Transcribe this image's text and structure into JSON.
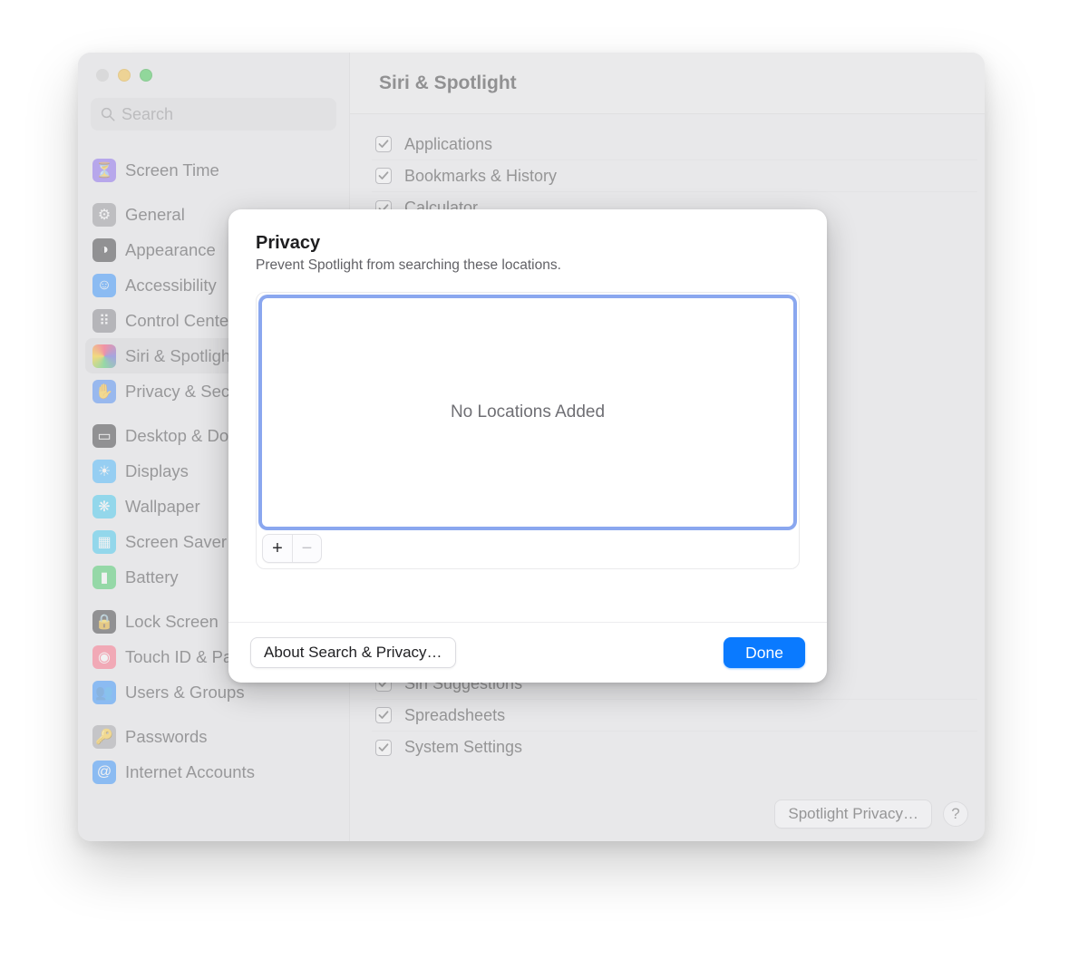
{
  "header": {
    "title": "Siri & Spotlight"
  },
  "search": {
    "placeholder": "Search"
  },
  "sidebar": {
    "groups": [
      {
        "items": [
          {
            "label": "Screen Time",
            "colorClass": "c-purple",
            "glyph": "⏳"
          }
        ]
      },
      {
        "items": [
          {
            "label": "General",
            "colorClass": "c-gray",
            "glyph": "⚙"
          },
          {
            "label": "Appearance",
            "colorClass": "c-black",
            "glyph": "◑"
          },
          {
            "label": "Accessibility",
            "colorClass": "c-blue",
            "glyph": "☺"
          },
          {
            "label": "Control Center",
            "colorClass": "c-darkgray",
            "glyph": "⠿"
          },
          {
            "label": "Siri & Spotlight",
            "colorClass": "c-siri",
            "glyph": "",
            "selected": true
          },
          {
            "label": "Privacy & Security",
            "colorClass": "c-hand",
            "glyph": "✋"
          }
        ]
      },
      {
        "items": [
          {
            "label": "Desktop & Dock",
            "colorClass": "c-black",
            "glyph": "▭"
          },
          {
            "label": "Displays",
            "colorClass": "c-bright",
            "glyph": "☀"
          },
          {
            "label": "Wallpaper",
            "colorClass": "c-teal",
            "glyph": "❋"
          },
          {
            "label": "Screen Saver",
            "colorClass": "c-teal",
            "glyph": "▦"
          },
          {
            "label": "Battery",
            "colorClass": "c-green",
            "glyph": "▮"
          }
        ]
      },
      {
        "items": [
          {
            "label": "Lock Screen",
            "colorClass": "c-black",
            "glyph": "🔒"
          },
          {
            "label": "Touch ID & Password",
            "colorClass": "c-pink",
            "glyph": "◉"
          },
          {
            "label": "Users & Groups",
            "colorClass": "c-blue",
            "glyph": "👥"
          }
        ]
      },
      {
        "items": [
          {
            "label": "Passwords",
            "colorClass": "c-lightgray",
            "glyph": "🔑"
          },
          {
            "label": "Internet Accounts",
            "colorClass": "c-blue",
            "glyph": "@"
          }
        ]
      }
    ]
  },
  "spotlight": {
    "results": [
      {
        "label": "Applications",
        "checked": true
      },
      {
        "label": "Bookmarks & History",
        "checked": true
      },
      {
        "label": "Calculator",
        "checked": true
      },
      {
        "label": "Siri Suggestions",
        "checked": true
      },
      {
        "label": "Spreadsheets",
        "checked": true
      },
      {
        "label": "System Settings",
        "checked": true
      }
    ],
    "privacy_button": "Spotlight Privacy…",
    "help_label": "?"
  },
  "modal": {
    "title": "Privacy",
    "subtitle": "Prevent Spotlight from searching these locations.",
    "empty_text": "No Locations Added",
    "add_label": "+",
    "remove_label": "−",
    "about_button": "About Search & Privacy…",
    "done_button": "Done"
  }
}
